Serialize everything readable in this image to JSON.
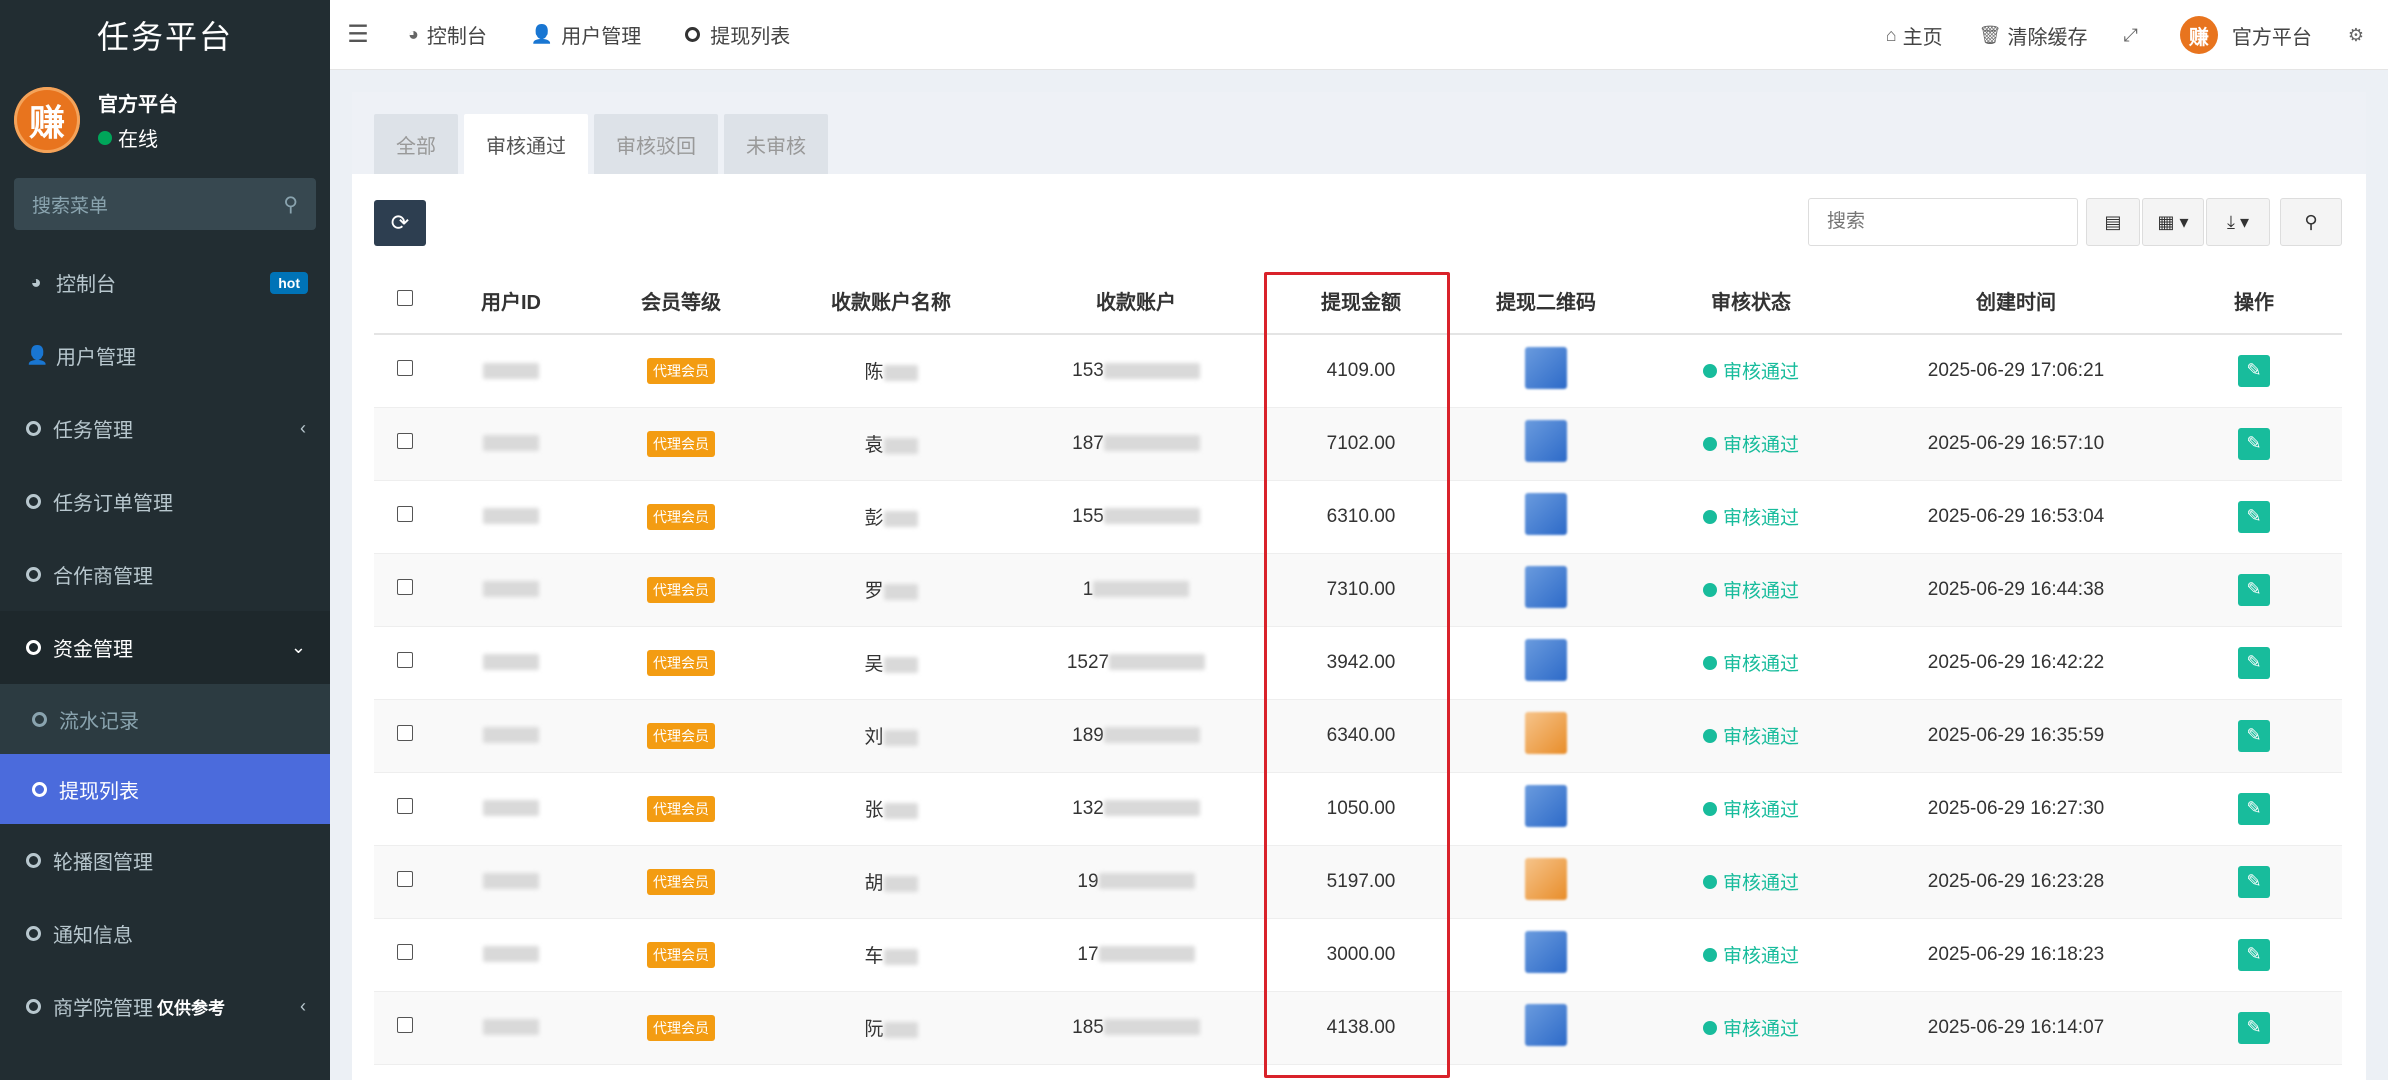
{
  "brand": "任务平台",
  "user": {
    "name": "官方平台",
    "status": "在线",
    "avatar_char": "赚"
  },
  "sidebar_search": {
    "placeholder": "搜索菜单"
  },
  "menu": [
    {
      "label": "控制台",
      "badge": "hot"
    },
    {
      "label": "用户管理"
    },
    {
      "label": "任务管理"
    },
    {
      "label": "任务订单管理"
    },
    {
      "label": "合作商管理"
    },
    {
      "label": "资金管理"
    },
    {
      "label": "流水记录"
    },
    {
      "label": "提现列表"
    },
    {
      "label": "轮播图管理"
    },
    {
      "label": "通知信息"
    },
    {
      "label": "商学院管理",
      "suffix": "仅供参考"
    }
  ],
  "topbar": {
    "tabs": [
      "控制台",
      "用户管理",
      "提现列表"
    ],
    "home": "主页",
    "clear_cache": "清除缓存",
    "user_name": "官方平台"
  },
  "filter_tabs": [
    "全部",
    "审核通过",
    "审核驳回",
    "未审核"
  ],
  "search": {
    "placeholder": "搜索"
  },
  "table": {
    "headers": [
      "用户ID",
      "会员等级",
      "收款账户名称",
      "收款账户",
      "提现金额",
      "提现二维码",
      "审核状态",
      "创建时间",
      "操作"
    ],
    "rows": [
      {
        "level": "代理会员",
        "name_prefix": "陈",
        "account_prefix": "153",
        "amount": "4109.00",
        "status": "审核通过",
        "time": "2025-06-29 17:06:21",
        "qr": "blue"
      },
      {
        "level": "代理会员",
        "name_prefix": "袁",
        "account_prefix": "187",
        "amount": "7102.00",
        "status": "审核通过",
        "time": "2025-06-29 16:57:10",
        "qr": "blue"
      },
      {
        "level": "代理会员",
        "name_prefix": "彭",
        "account_prefix": "155",
        "amount": "6310.00",
        "status": "审核通过",
        "time": "2025-06-29 16:53:04",
        "qr": "blue"
      },
      {
        "level": "代理会员",
        "name_prefix": "罗",
        "account_prefix": "1",
        "amount": "7310.00",
        "status": "审核通过",
        "time": "2025-06-29 16:44:38",
        "qr": "blue"
      },
      {
        "level": "代理会员",
        "name_prefix": "吴",
        "account_prefix": "1527",
        "amount": "3942.00",
        "status": "审核通过",
        "time": "2025-06-29 16:42:22",
        "qr": "blue"
      },
      {
        "level": "代理会员",
        "name_prefix": "刘",
        "account_prefix": "189",
        "amount": "6340.00",
        "status": "审核通过",
        "time": "2025-06-29 16:35:59",
        "qr": "orange"
      },
      {
        "level": "代理会员",
        "name_prefix": "张",
        "account_prefix": "132",
        "amount": "1050.00",
        "status": "审核通过",
        "time": "2025-06-29 16:27:30",
        "qr": "blue"
      },
      {
        "level": "代理会员",
        "name_prefix": "胡",
        "account_prefix": "19",
        "amount": "5197.00",
        "status": "审核通过",
        "time": "2025-06-29 16:23:28",
        "qr": "orange"
      },
      {
        "level": "代理会员",
        "name_prefix": "车",
        "account_prefix": "17",
        "amount": "3000.00",
        "status": "审核通过",
        "time": "2025-06-29 16:18:23",
        "qr": "blue"
      },
      {
        "level": "代理会员",
        "name_prefix": "阮",
        "account_prefix": "185",
        "amount": "4138.00",
        "status": "审核通过",
        "time": "2025-06-29 16:14:07",
        "qr": "blue"
      }
    ]
  }
}
